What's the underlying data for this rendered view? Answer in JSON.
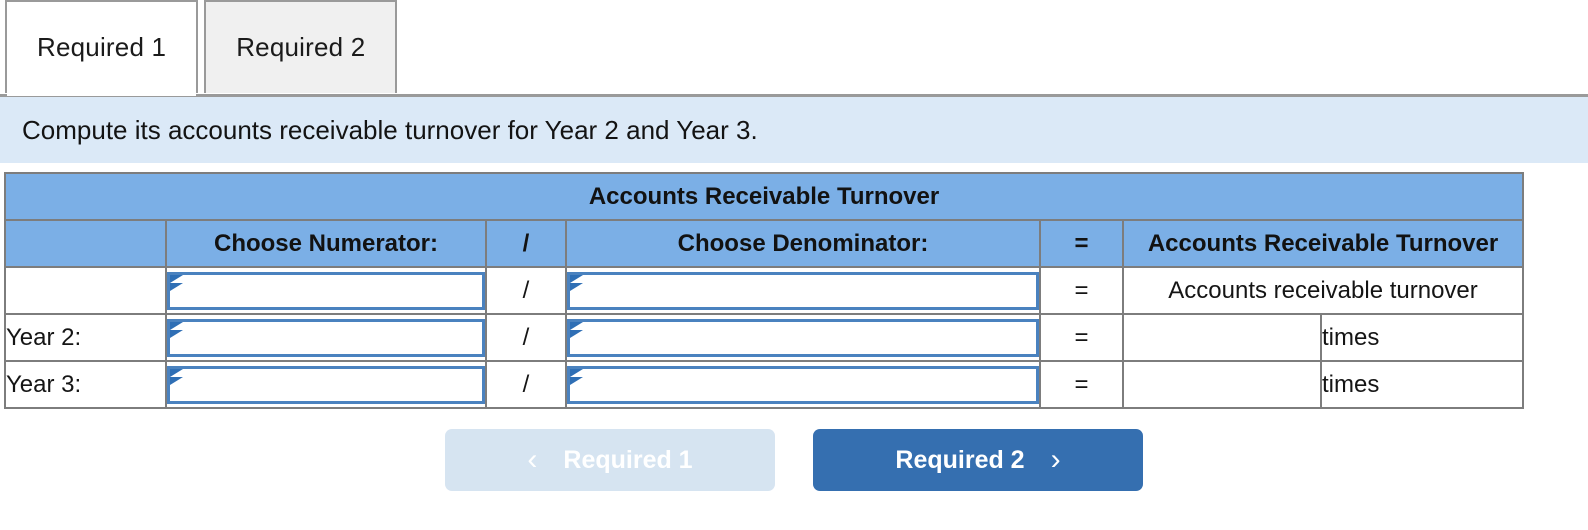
{
  "tabs": [
    {
      "label": "Required 1",
      "active": true
    },
    {
      "label": "Required 2",
      "active": false
    }
  ],
  "instruction": {
    "text": "Compute its accounts receivable turnover for Year 2 and Year 3."
  },
  "table": {
    "title": "Accounts Receivable Turnover",
    "headers": {
      "blank": "",
      "numerator": "Choose Numerator:",
      "slash": "/",
      "denominator": "Choose Denominator:",
      "equals": "=",
      "result": "Accounts Receivable Turnover"
    },
    "rows": [
      {
        "label": "",
        "numerator_value": "",
        "slash": "/",
        "denominator_value": "",
        "equals": "=",
        "result_text": "Accounts receivable turnover",
        "result_value": "",
        "unit": ""
      },
      {
        "label": "Year 2:",
        "numerator_value": "",
        "slash": "/",
        "denominator_value": "",
        "equals": "=",
        "result_text": "",
        "result_value": "",
        "unit": "times"
      },
      {
        "label": "Year 3:",
        "numerator_value": "",
        "slash": "/",
        "denominator_value": "",
        "equals": "=",
        "result_text": "",
        "result_value": "",
        "unit": "times"
      }
    ]
  },
  "footer": {
    "prev_label": "Required 1",
    "prev_chevron": "‹",
    "next_label": "Required 2",
    "next_chevron": "›"
  },
  "colors": {
    "header_blue": "#7bafe6",
    "banner_blue": "#dbe9f7",
    "button_blue": "#356fb0",
    "button_disabled": "#d6e4f1",
    "input_border": "#4a82bf",
    "grid_line": "#7d7d7d"
  }
}
